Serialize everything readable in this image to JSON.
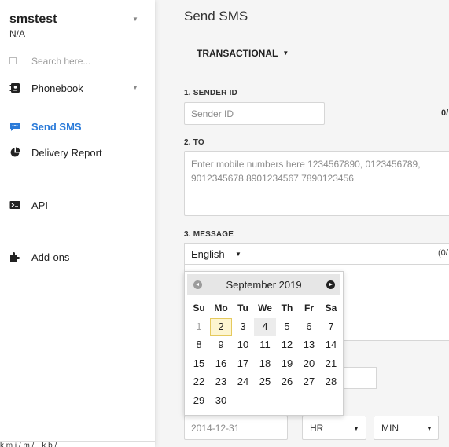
{
  "sidebar": {
    "user_name": "smstest",
    "user_sub": "N/A",
    "search_placeholder": "Search here...",
    "items": [
      {
        "label": "Phonebook",
        "icon": "phonebook-icon",
        "has_caret": true
      },
      {
        "label": "Send SMS",
        "icon": "chat-icon",
        "active": true
      },
      {
        "label": "Delivery Report",
        "icon": "pie-chart-icon"
      },
      {
        "label": "API",
        "icon": "terminal-icon"
      },
      {
        "label": "Add-ons",
        "icon": "puzzle-icon"
      }
    ],
    "status_url": "k          m      i    /    m   /i   l   k    b   /"
  },
  "main": {
    "title": "Send SMS",
    "message_type": "TRANSACTIONAL",
    "sender": {
      "label": "1. SENDER ID",
      "placeholder": "Sender ID",
      "count": "0/"
    },
    "to": {
      "label": "2. TO",
      "placeholder": "Enter mobile numbers here 1234567890, 0123456789, 9012345678 8901234567 7890123456"
    },
    "message": {
      "label": "3. MESSAGE",
      "language": "English",
      "count": "(0/"
    },
    "schedule": {
      "date_placeholder": "2014-12-31",
      "hour": "HR",
      "minute": "MIN"
    }
  },
  "calendar": {
    "month_title": "September 2019",
    "weekdays": [
      "Su",
      "Mo",
      "Tu",
      "We",
      "Th",
      "Fr",
      "Sa"
    ],
    "weeks": [
      [
        "1",
        "2",
        "3",
        "4",
        "5",
        "6",
        "7"
      ],
      [
        "8",
        "9",
        "10",
        "11",
        "12",
        "13",
        "14"
      ],
      [
        "15",
        "16",
        "17",
        "18",
        "19",
        "20",
        "21"
      ],
      [
        "22",
        "23",
        "24",
        "25",
        "26",
        "27",
        "28"
      ],
      [
        "29",
        "30",
        "",
        "",
        "",
        "",
        ""
      ]
    ],
    "disabled_day": "1",
    "today": "2",
    "hovered_day": "4"
  },
  "colors": {
    "accent": "#2b7bd9",
    "today_bg": "#fdf5d0"
  }
}
